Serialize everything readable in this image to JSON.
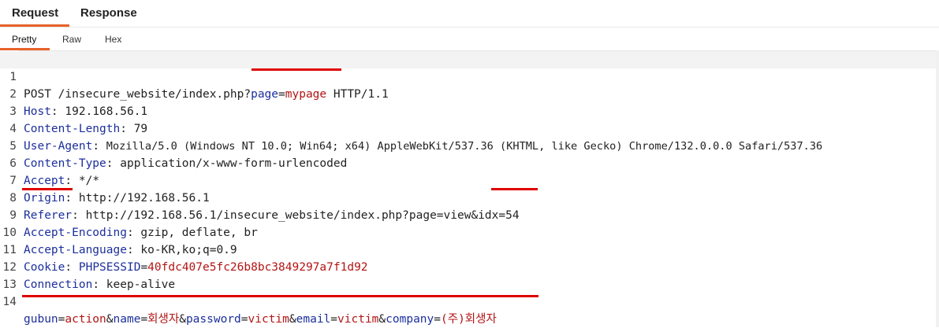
{
  "tabs": {
    "request": "Request",
    "response": "Response"
  },
  "subtabs": {
    "pretty": "Pretty",
    "raw": "Raw",
    "hex": "Hex"
  },
  "lines": [
    {
      "n": "1",
      "method": "POST /insecure_website/index.php?",
      "pname": "page",
      "eq": "=",
      "pval": "mypage",
      "tail": " HTTP/1.1"
    },
    {
      "n": "2",
      "name": "Host",
      "sep": ": ",
      "value": "192.168.56.1"
    },
    {
      "n": "3",
      "name": "Content-Length",
      "sep": ": ",
      "value": "79"
    },
    {
      "n": "4",
      "name": "User-Agent",
      "sep": ": ",
      "value": "Mozilla/5.0 (Windows NT 10.0; Win64; x64) AppleWebKit/537.36 (KHTML, like Gecko) Chrome/132.0.0.0 Safari/537.36"
    },
    {
      "n": "5",
      "name": "Content-Type",
      "sep": ": ",
      "value": "application/x-www-form-urlencoded"
    },
    {
      "n": "6",
      "name": "Accept",
      "sep": ": ",
      "value": "*/*"
    },
    {
      "n": "7",
      "name": "Origin",
      "sep": ": ",
      "value": "http://192.168.56.1"
    },
    {
      "n": "8",
      "name": "Referer",
      "sep": ": ",
      "value_pre": "http://192.168.56.1/insecure_website/index.php?page=view&",
      "idx": "idx=54"
    },
    {
      "n": "9",
      "name": "Accept-Encoding",
      "sep": ": ",
      "value": "gzip, deflate, br"
    },
    {
      "n": "10",
      "name": "Accept-Language",
      "sep": ": ",
      "value": "ko-KR,ko;q=0.9"
    },
    {
      "n": "11",
      "name": "Cookie",
      "sep": ": ",
      "cname": "PHPSESSID",
      "ceq": "=",
      "cval": "40fdc407e5fc26b8bc3849297a7f1d92"
    },
    {
      "n": "12",
      "name": "Connection",
      "sep": ": ",
      "value": "keep-alive"
    },
    {
      "n": "13"
    },
    {
      "n": "14",
      "body": [
        {
          "k": "gubun",
          "v": "action"
        },
        {
          "k": "name",
          "v": "회생자"
        },
        {
          "k": "password",
          "v": "victim"
        },
        {
          "k": "email",
          "v": "victim"
        },
        {
          "k": "company",
          "v": "(주)회생자"
        }
      ]
    }
  ],
  "colors": {
    "accent": "#e8622a",
    "header_name": "#1c2f9c",
    "param_value": "#b31414",
    "annotation": "#e00000"
  }
}
